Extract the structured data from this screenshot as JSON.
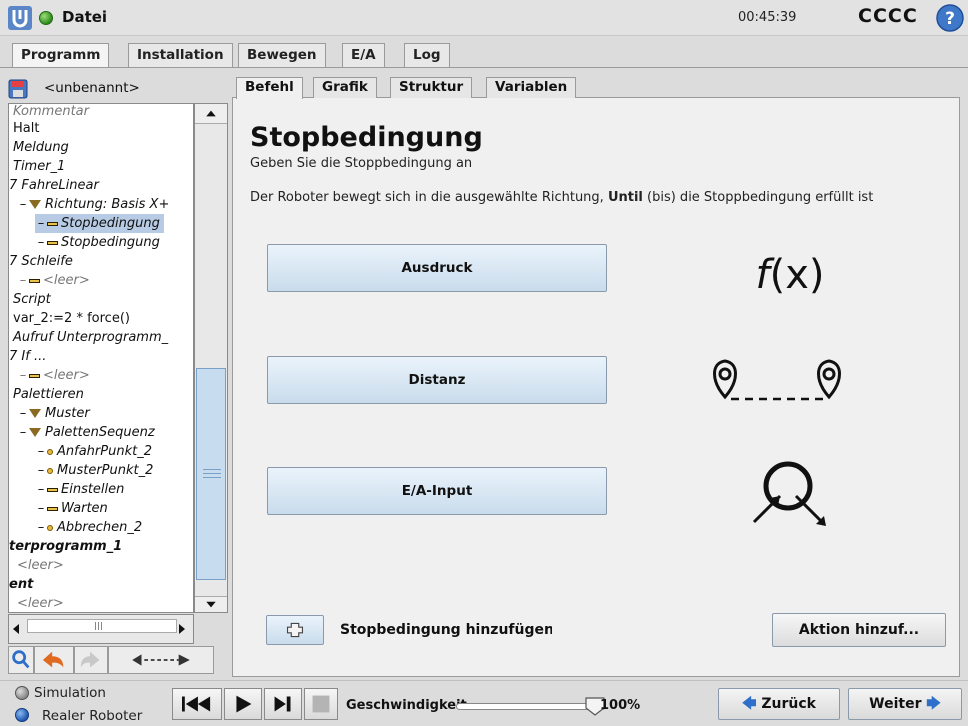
{
  "topbar": {
    "file_label": "Datei",
    "clock": "00:45:39",
    "robot_name": "CCCC"
  },
  "main_tabs": [
    {
      "label": "Programm",
      "active": true
    },
    {
      "label": "Installation",
      "active": false
    },
    {
      "label": "Bewegen",
      "active": false
    },
    {
      "label": "E/A",
      "active": false
    },
    {
      "label": "Log",
      "active": false
    }
  ],
  "left": {
    "file_name": "<unbenannt>",
    "tree": [
      {
        "label": "Kommentar",
        "style": "grey"
      },
      {
        "label": "Halt",
        "style": "normal"
      },
      {
        "label": "Meldung",
        "style": "italic"
      },
      {
        "label": "Timer_1",
        "style": "italic"
      },
      {
        "label": "7 FahreLinear",
        "style": "italic"
      },
      {
        "label": "Richtung: Basis X+",
        "style": "italic"
      },
      {
        "label": "Stopbedingung",
        "style": "italic"
      },
      {
        "label": "Stopbedingung",
        "style": "italic"
      },
      {
        "label": "7 Schleife",
        "style": "italic"
      },
      {
        "label": "<leer>",
        "style": "grey"
      },
      {
        "label": "Script",
        "style": "italic"
      },
      {
        "label": "var_2:=2 * force()",
        "style": "normal"
      },
      {
        "label": "Aufruf Unterprogramm_",
        "style": "italic"
      },
      {
        "label": "7 If ...",
        "style": "italic"
      },
      {
        "label": "<leer>",
        "style": "grey"
      },
      {
        "label": "Palettieren",
        "style": "italic"
      },
      {
        "label": "Muster",
        "style": "italic"
      },
      {
        "label": "PalettenSequenz",
        "style": "italic"
      },
      {
        "label": "AnfahrPunkt_2",
        "style": "italic"
      },
      {
        "label": "MusterPunkt_2",
        "style": "italic"
      },
      {
        "label": "Einstellen",
        "style": "italic"
      },
      {
        "label": "Warten",
        "style": "italic"
      },
      {
        "label": "Abbrechen_2",
        "style": "italic"
      },
      {
        "label": "terprogramm_1",
        "style": "bold"
      },
      {
        "label": "<leer>",
        "style": "grey"
      },
      {
        "label": "ent",
        "style": "bold"
      },
      {
        "label": "<leer>",
        "style": "grey"
      }
    ]
  },
  "sub_tabs": [
    {
      "label": "Befehl",
      "active": true
    },
    {
      "label": "Grafik",
      "active": false
    },
    {
      "label": "Struktur",
      "active": false
    },
    {
      "label": "Variablen",
      "active": false
    }
  ],
  "content": {
    "title": "Stopbedingung",
    "subtitle": "Geben Sie die Stoppbedingung an",
    "desc_before": "Der Roboter bewegt sich in die ausgewählte Richtung, ",
    "desc_bold": "Until",
    "desc_after": " (bis) die Stoppbedingung erfüllt ist",
    "options": [
      {
        "label": "Ausdruck",
        "icon": "function-icon",
        "icon_text": "f(x)"
      },
      {
        "label": "Distanz",
        "icon": "distance-icon"
      },
      {
        "label": "E/A-Input",
        "icon": "io-input-icon"
      }
    ],
    "add_stop_label": "Stopbedingung hinzufügen",
    "add_action_label": "Aktion hinzuf..."
  },
  "bottombar": {
    "simulation_label": "Simulation",
    "real_robot_label": "Realer Roboter",
    "speed_label": "Geschwindigkeit",
    "speed_value": "100%",
    "speed_fraction": 1.0,
    "back_label": "Zurück",
    "next_label": "Weiter"
  }
}
